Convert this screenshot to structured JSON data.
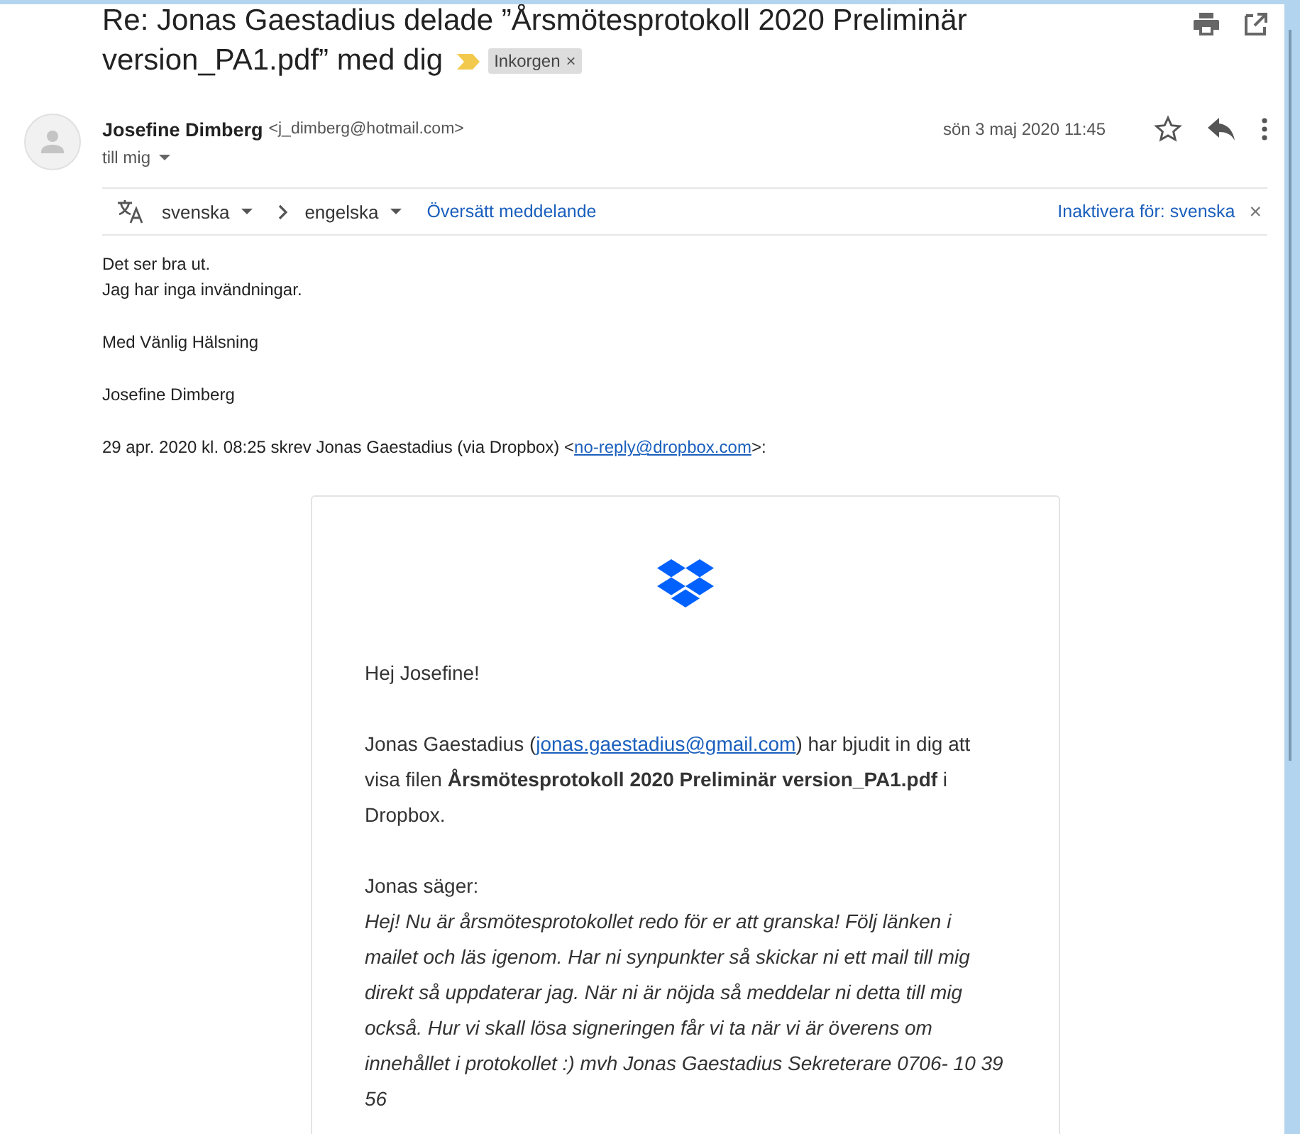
{
  "subject": {
    "title_lines": [
      "Re: Jonas Gaestadius delade ”Årsmötesprotokoll 2020 Preliminär",
      "version_PA1.pdf” med dig"
    ],
    "important": true,
    "label": {
      "text": "Inkorgen",
      "remove": "×"
    }
  },
  "message": {
    "sender_name": "Josefine Dimberg",
    "sender_email": "<j_dimberg@hotmail.com>",
    "recipient": "till mig",
    "date": "sön 3 maj 2020 11:45",
    "starred": false
  },
  "translation_bar": {
    "from": "svenska",
    "to": "engelska",
    "translate": "Översätt meddelande",
    "disable": "Inaktivera för: svenska",
    "close": "×"
  },
  "body_lines": [
    "Det ser bra ut.\nJag har inga invändningar.",
    "Med Vänlig Hälsning",
    "Josefine Dimberg"
  ],
  "quote_header": {
    "before": "29 apr. 2020 kl. 08:25 skrev Jonas Gaestadius (via Dropbox) <",
    "link": "no-reply@dropbox.com",
    "after": ">:"
  },
  "card": {
    "greeting": "Hej Josefine!",
    "invite": {
      "before": "Jonas Gaestadius (",
      "link": "jonas.gaestadius@gmail.com",
      "after": ") har bjudit in dig att visa filen **Årsmötesprotokoll 2020 Preliminär version_PA1.pdf** i Dropbox."
    },
    "says": "Jonas säger:",
    "quote": "Hej! Nu är årsmötesprotokollet redo för er att granska! Följ länken i mailet och läs igenom. Har ni synpunkter så skickar ni ett mail till mig direkt så uppdaterar jag. När ni är nöjda så meddelar ni detta till mig också. Hur vi skall lösa signeringen får vi ta när vi är överens om innehållet i protokollet :) mvh Jonas Gaestadius Sekreterare 0706- 10 39 56"
  }
}
